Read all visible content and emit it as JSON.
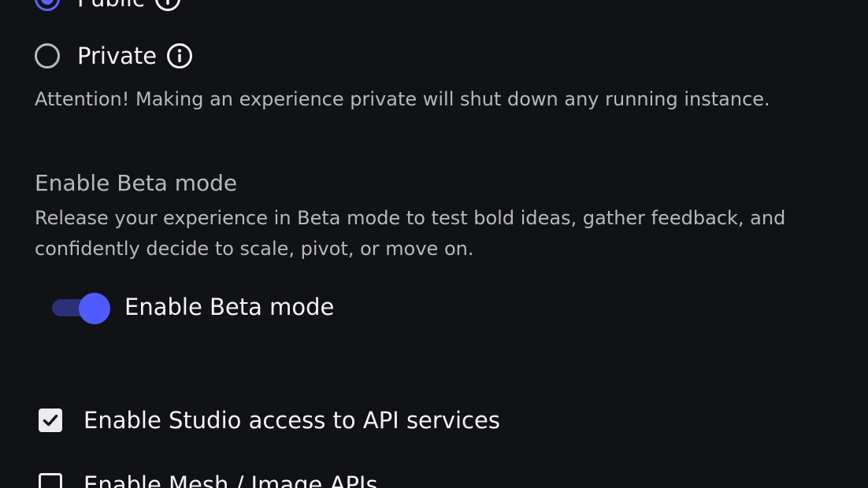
{
  "visibility": {
    "options": [
      {
        "label": "Public",
        "selected": true
      },
      {
        "label": "Private",
        "selected": false
      }
    ],
    "attention": "Attention! Making an experience private will shut down any running instance."
  },
  "beta": {
    "title": "Enable Beta mode",
    "description": "Release your experience in Beta mode to test bold ideas, gather feedback, and confidently decide to scale, pivot, or move on.",
    "toggle_label": "Enable Beta mode",
    "toggle_on": true
  },
  "api": {
    "options": [
      {
        "label": "Enable Studio access to API services",
        "checked": true
      },
      {
        "label": "Enable Mesh / Image APIs",
        "checked": false
      }
    ]
  },
  "colors": {
    "background": "#111216",
    "accent": "#5a63ff",
    "muted_text": "#b7b8bc"
  }
}
